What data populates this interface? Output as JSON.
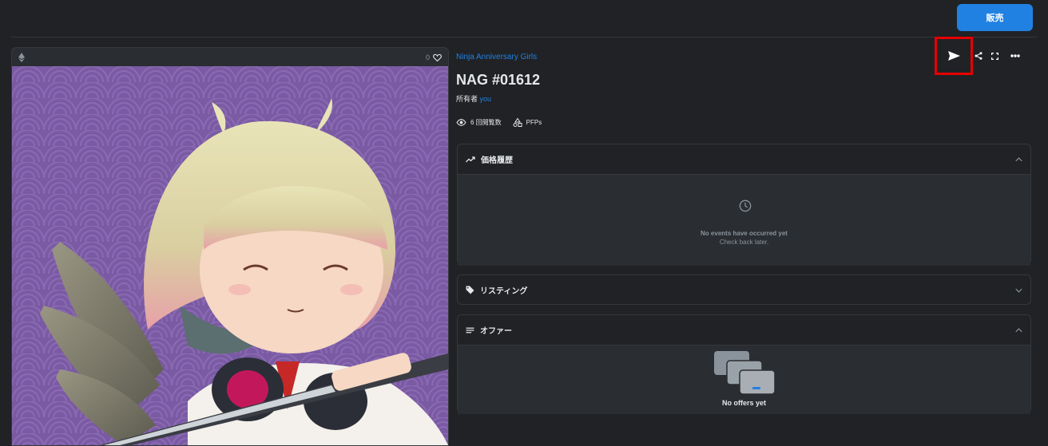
{
  "header": {
    "sell_label": "販売"
  },
  "image_panel": {
    "like_count": "0"
  },
  "item": {
    "collection": "Ninja Anniversary Girls",
    "title": "NAG #01612",
    "owner_label": "所有者",
    "owner_name": "you",
    "views": "6 回閲覧数",
    "category": "PFPs"
  },
  "price_history": {
    "title": "価格履歴",
    "empty_title": "No events have occurred yet",
    "empty_sub": "Check back later."
  },
  "listings": {
    "title": "リスティング"
  },
  "offers": {
    "title": "オファー",
    "empty": "No offers yet"
  },
  "colors": {
    "accent": "#2081e2",
    "highlight": "#e60000",
    "background": "#202225"
  }
}
